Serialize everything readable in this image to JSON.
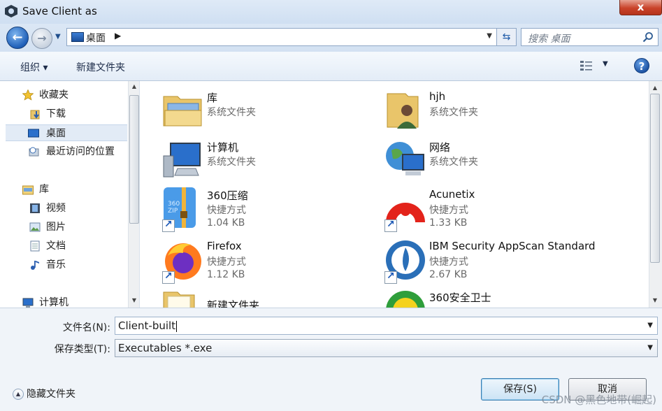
{
  "window": {
    "title": "Save Client as",
    "close_label": "x"
  },
  "nav": {
    "back_glyph": "←",
    "forward_glyph": "→",
    "address_location": "桌面",
    "address_chevron": "▶",
    "search_placeholder": "搜索 桌面"
  },
  "toolbar": {
    "organize_label": "组织 ▾",
    "new_folder_label": "新建文件夹",
    "help_label": "?"
  },
  "sidebar": {
    "items": [
      {
        "label": "收藏夹",
        "icon": "star-icon"
      },
      {
        "label": "下载",
        "icon": "download-folder-icon"
      },
      {
        "label": "桌面",
        "icon": "desktop-icon"
      },
      {
        "label": "最近访问的位置",
        "icon": "recent-places-icon"
      },
      {
        "label": "库",
        "icon": "library-icon"
      },
      {
        "label": "视频",
        "icon": "video-icon"
      },
      {
        "label": "图片",
        "icon": "pictures-icon"
      },
      {
        "label": "文档",
        "icon": "documents-icon"
      },
      {
        "label": "音乐",
        "icon": "music-icon"
      },
      {
        "label": "计算机",
        "icon": "computer-icon"
      }
    ]
  },
  "files": [
    {
      "name": "库",
      "type": "系统文件夹",
      "size": "",
      "icon": "library-folder-icon"
    },
    {
      "name": "hjh",
      "type": "系统文件夹",
      "size": "",
      "icon": "user-folder-icon"
    },
    {
      "name": "计算机",
      "type": "系统文件夹",
      "size": "",
      "icon": "computer-icon"
    },
    {
      "name": "网络",
      "type": "系统文件夹",
      "size": "",
      "icon": "network-icon"
    },
    {
      "name": "360压缩",
      "type": "快捷方式",
      "size": "1.04 KB",
      "icon": "archive-app-icon"
    },
    {
      "name": "Acunetix",
      "type": "快捷方式",
      "size": "1.33 KB",
      "icon": "acunetix-app-icon"
    },
    {
      "name": "Firefox",
      "type": "快捷方式",
      "size": "1.12 KB",
      "icon": "firefox-icon"
    },
    {
      "name": "IBM Security AppScan Standard",
      "type": "快捷方式",
      "size": "2.67 KB",
      "icon": "appscan-icon"
    },
    {
      "name": "新建文件夹",
      "type": "",
      "size": "",
      "icon": "folder-icon"
    },
    {
      "name": "360安全卫士",
      "type": "",
      "size": "",
      "icon": "security-app-icon"
    }
  ],
  "form": {
    "filename_label": "文件名(N):",
    "filename_value": "Client-built",
    "filetype_label": "保存类型(T):",
    "filetype_value": "Executables *.exe",
    "hide_folders_label": "隐藏文件夹",
    "save_label": "保存(S)",
    "cancel_label": "取消"
  },
  "watermark": "CSDN @黑色地带(崛起)",
  "colors": {
    "accent": "#1f5fb8",
    "close": "#c9432a",
    "selection": "#e2ebf6"
  }
}
